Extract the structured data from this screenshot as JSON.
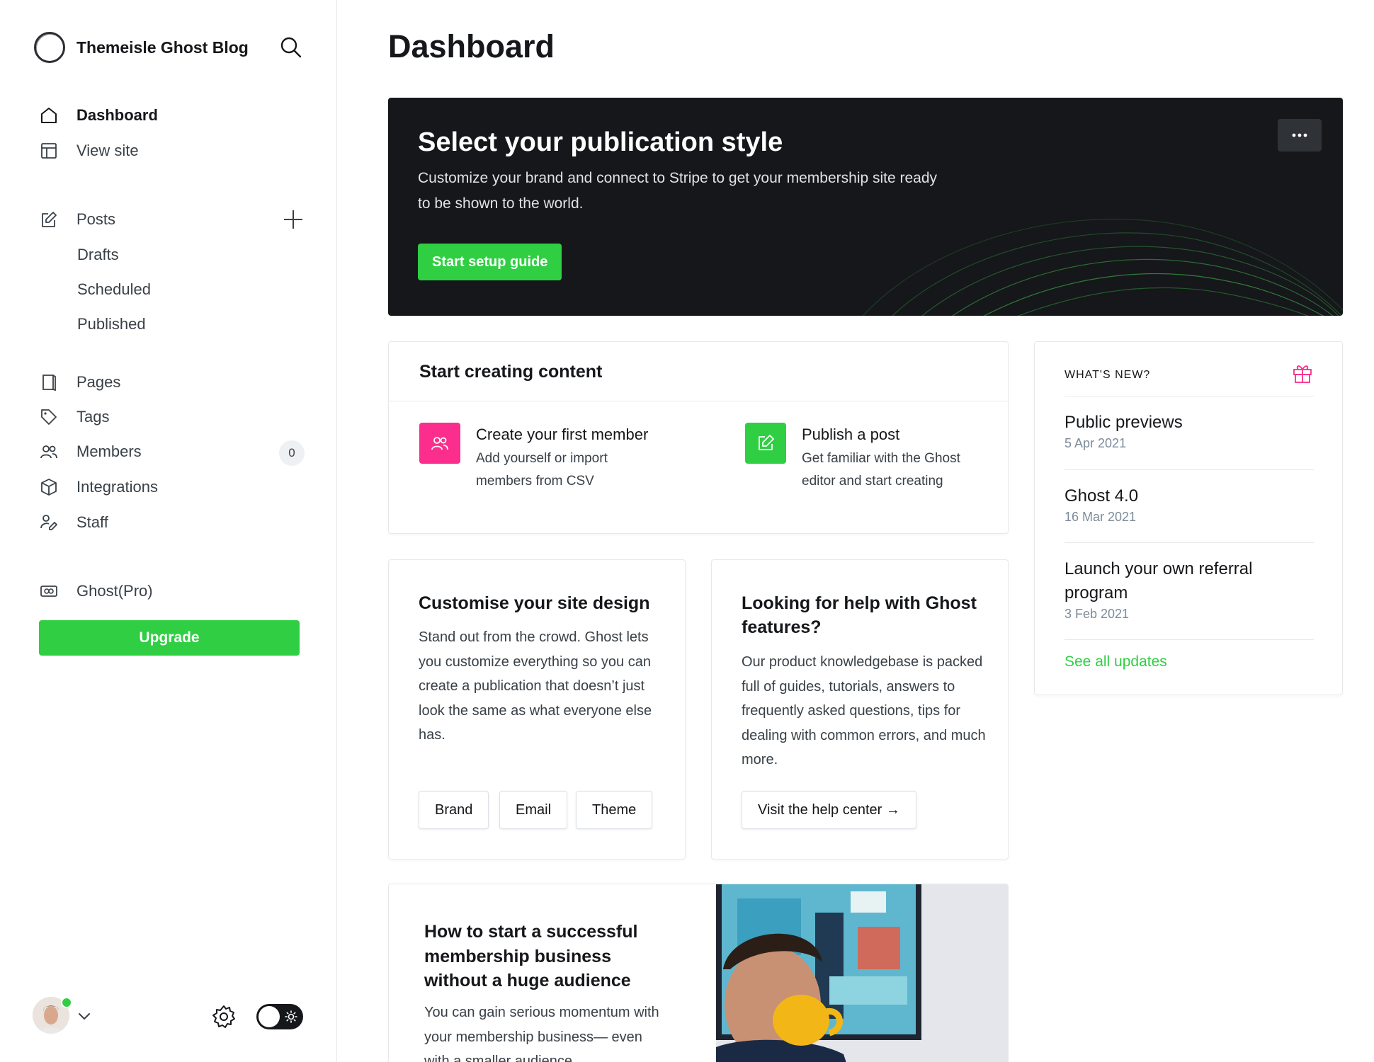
{
  "sidebar": {
    "site_name": "Themeisle Ghost Blog",
    "nav": {
      "dashboard": "Dashboard",
      "view_site": "View site",
      "posts": "Posts",
      "drafts": "Drafts",
      "scheduled": "Scheduled",
      "published": "Published",
      "pages": "Pages",
      "tags": "Tags",
      "members": "Members",
      "members_count": "0",
      "integrations": "Integrations",
      "staff": "Staff",
      "ghost_pro": "Ghost(Pro)"
    },
    "upgrade_label": "Upgrade"
  },
  "main": {
    "title": "Dashboard",
    "hero": {
      "title": "Select your publication style",
      "description": "Customize your brand and connect to Stripe to get your membership site ready to be shown to the world.",
      "button": "Start setup guide"
    },
    "start_content": {
      "heading": "Start creating content",
      "items": [
        {
          "title": "Create your first member",
          "description": "Add yourself or import members from CSV"
        },
        {
          "title": "Publish a post",
          "description": "Get familiar with the Ghost editor and start creating"
        }
      ]
    },
    "customise": {
      "title": "Customise your site design",
      "description": "Stand out from the crowd. Ghost lets you customize everything so you can create a publication that doesn’t just look the same as what everyone else has.",
      "buttons": [
        "Brand",
        "Email",
        "Theme"
      ]
    },
    "help": {
      "title": "Looking for help with Ghost features?",
      "description": "Our product knowledgebase is packed full of guides, tutorials, answers to frequently asked questions, tips for dealing with common errors, and much more.",
      "button": "Visit the help center →"
    },
    "blog": {
      "title": "How to start a successful membership business without a huge audience",
      "description": "You can gain serious momentum with your membership business— even with a smaller audience."
    },
    "whats_new": {
      "label": "WHAT'S NEW?",
      "items": [
        {
          "title": "Public previews",
          "date": "5 Apr 2021"
        },
        {
          "title": "Ghost 4.0",
          "date": "16 Mar 2021"
        },
        {
          "title": "Launch your own referral program",
          "date": "3 Feb 2021"
        }
      ],
      "see_all": "See all updates"
    }
  },
  "colors": {
    "accent_green": "#30cf43",
    "member_pink": "#fb2d8d",
    "hero_bg": "#15171a",
    "text_dark": "#15171a",
    "text_muted": "#7c8b9a"
  },
  "icons": [
    "search-icon",
    "home-icon",
    "view-site-icon",
    "posts-icon",
    "plus-icon",
    "pages-icon",
    "tags-icon",
    "members-icon",
    "integrations-icon",
    "staff-icon",
    "ghost-pro-icon",
    "chevron-down-icon",
    "gear-icon",
    "sun-icon",
    "more-icon",
    "member-icon",
    "edit-icon",
    "gift-icon"
  ]
}
